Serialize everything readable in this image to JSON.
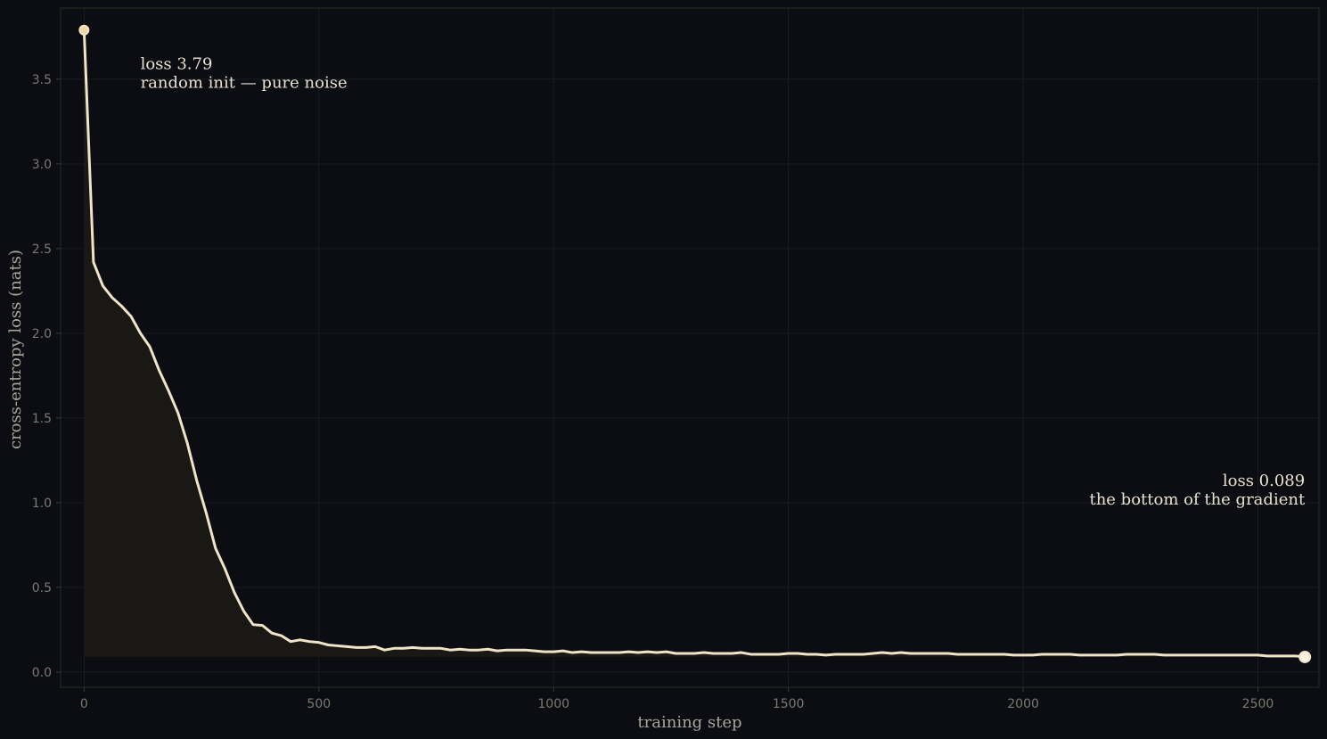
{
  "chart_data": {
    "type": "line",
    "xlabel": "training step",
    "ylabel": "cross-entropy loss  (nats)",
    "xlim": [
      -50,
      2630
    ],
    "ylim": [
      -0.09,
      3.92
    ],
    "x_ticks": [
      0,
      500,
      1000,
      1500,
      2000,
      2500
    ],
    "y_ticks": [
      0.0,
      0.5,
      1.0,
      1.5,
      2.0,
      2.5,
      3.0,
      3.5
    ],
    "grid": true,
    "area_fill": true,
    "colors": {
      "line": "#efe3c8",
      "fill": "#1a1814",
      "background": "#0b0d12",
      "marker_fill_start": "#f2d4a6",
      "marker_fill_end": "#fbf3e0"
    },
    "annotations": [
      {
        "lines": [
          "loss 3.79",
          "random init — pure noise"
        ],
        "x": 120,
        "y": 3.45,
        "align": "left"
      },
      {
        "lines": [
          "loss 0.089",
          "the bottom of the gradient"
        ],
        "x": 2600,
        "y": 0.99,
        "align": "right"
      }
    ],
    "series": [
      {
        "x": [
          0,
          20,
          40,
          60,
          80,
          100,
          120,
          140,
          160,
          180,
          200,
          220,
          240,
          260,
          280,
          300,
          320,
          340,
          360,
          380,
          400,
          420,
          440,
          460,
          480,
          500,
          520,
          540,
          560,
          580,
          600,
          620,
          640,
          660,
          680,
          700,
          720,
          740,
          760,
          780,
          800,
          820,
          840,
          860,
          880,
          900,
          920,
          940,
          960,
          980,
          1000,
          1020,
          1040,
          1060,
          1080,
          1100,
          1120,
          1140,
          1160,
          1180,
          1200,
          1220,
          1240,
          1260,
          1280,
          1300,
          1320,
          1340,
          1360,
          1380,
          1400,
          1420,
          1440,
          1460,
          1480,
          1500,
          1520,
          1540,
          1560,
          1580,
          1600,
          1620,
          1640,
          1660,
          1680,
          1700,
          1720,
          1740,
          1760,
          1780,
          1800,
          1820,
          1840,
          1860,
          1880,
          1900,
          1920,
          1940,
          1960,
          1980,
          2000,
          2020,
          2040,
          2060,
          2080,
          2100,
          2120,
          2140,
          2160,
          2180,
          2200,
          2220,
          2240,
          2260,
          2280,
          2300,
          2320,
          2340,
          2360,
          2380,
          2400,
          2420,
          2440,
          2460,
          2480,
          2500,
          2520,
          2540,
          2560,
          2580,
          2600
        ],
        "y": [
          3.79,
          2.42,
          2.28,
          2.21,
          2.16,
          2.1,
          2.0,
          1.92,
          1.78,
          1.66,
          1.53,
          1.35,
          1.13,
          0.94,
          0.73,
          0.61,
          0.47,
          0.36,
          0.28,
          0.275,
          0.23,
          0.215,
          0.18,
          0.19,
          0.18,
          0.175,
          0.16,
          0.155,
          0.15,
          0.145,
          0.145,
          0.15,
          0.13,
          0.14,
          0.14,
          0.145,
          0.14,
          0.14,
          0.14,
          0.13,
          0.135,
          0.13,
          0.13,
          0.135,
          0.125,
          0.13,
          0.13,
          0.13,
          0.125,
          0.12,
          0.12,
          0.125,
          0.115,
          0.12,
          0.115,
          0.115,
          0.115,
          0.115,
          0.12,
          0.115,
          0.12,
          0.115,
          0.12,
          0.11,
          0.11,
          0.11,
          0.115,
          0.11,
          0.11,
          0.11,
          0.115,
          0.105,
          0.105,
          0.105,
          0.105,
          0.11,
          0.11,
          0.105,
          0.105,
          0.1,
          0.105,
          0.105,
          0.105,
          0.105,
          0.11,
          0.115,
          0.11,
          0.115,
          0.11,
          0.11,
          0.11,
          0.11,
          0.11,
          0.105,
          0.105,
          0.105,
          0.105,
          0.105,
          0.105,
          0.1,
          0.1,
          0.1,
          0.105,
          0.105,
          0.105,
          0.105,
          0.1,
          0.1,
          0.1,
          0.1,
          0.1,
          0.105,
          0.105,
          0.105,
          0.105,
          0.1,
          0.1,
          0.1,
          0.1,
          0.1,
          0.1,
          0.1,
          0.1,
          0.1,
          0.1,
          0.1,
          0.095,
          0.095,
          0.095,
          0.095,
          0.089
        ]
      }
    ]
  }
}
